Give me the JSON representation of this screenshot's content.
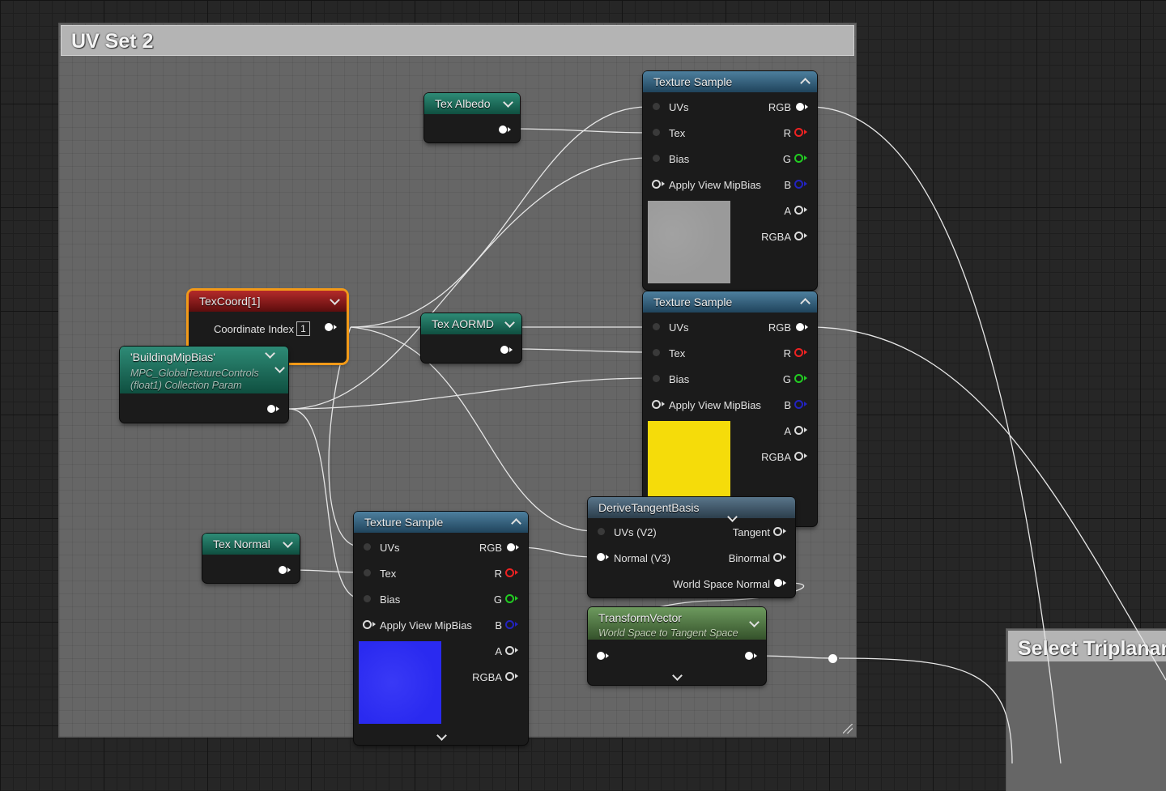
{
  "comments": {
    "main_title": "UV Set 2",
    "side_title": "Select Triplanar"
  },
  "nodes": {
    "tex_albedo": {
      "title": "Tex Albedo"
    },
    "tex_aormd": {
      "title": "Tex AORMD"
    },
    "tex_normal": {
      "title": "Tex Normal"
    },
    "texcoord": {
      "title": "TexCoord[1]",
      "param_label": "Coordinate Index",
      "param_value": "1"
    },
    "mip_bias": {
      "title": "'BuildingMipBias'",
      "sub1": "MPC_GlobalTextureControls",
      "sub2": "(float1) Collection Param"
    },
    "texture_sample": {
      "title": "Texture Sample",
      "inputs": [
        "UVs",
        "Tex",
        "Bias",
        "Apply View MipBias"
      ],
      "outputs": [
        "RGB",
        "R",
        "G",
        "B",
        "A",
        "RGBA"
      ]
    },
    "derive_tangent": {
      "title": "DeriveTangentBasis",
      "in1": "UVs (V2)",
      "in2": "Normal (V3)",
      "out1": "Tangent",
      "out2": "Binormal",
      "out3": "World Space Normal"
    },
    "transform_vector": {
      "title": "TransformVector",
      "subtitle": "World Space to Tangent Space"
    }
  },
  "colors": {
    "preview_albedo": "#9a9a9a",
    "preview_aormd": "#f5dc0a",
    "preview_normal": "#2a2af0"
  }
}
